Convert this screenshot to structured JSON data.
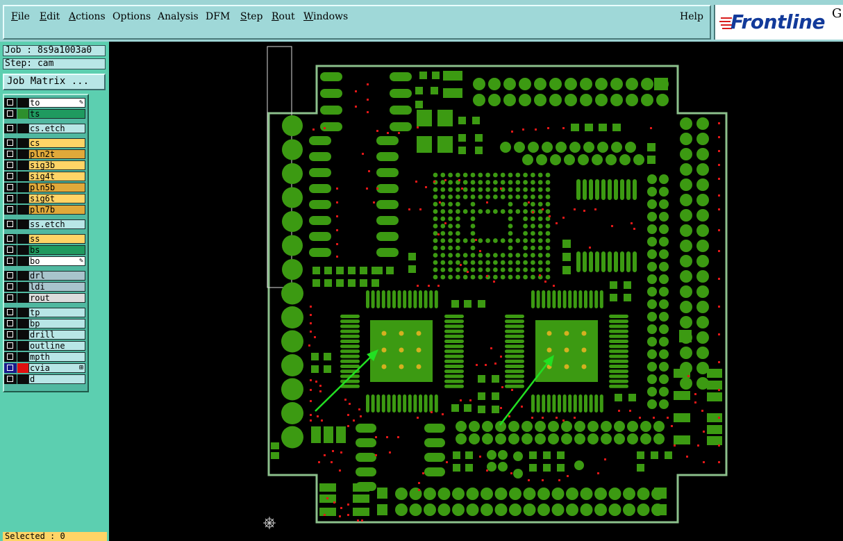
{
  "menu": {
    "items": [
      {
        "label": "File",
        "accel": 0
      },
      {
        "label": "Edit",
        "accel": 0
      },
      {
        "label": "Actions",
        "accel": 0
      },
      {
        "label": "Options",
        "accel": -1
      },
      {
        "label": "Analysis",
        "accel": -1
      },
      {
        "label": "DFM",
        "accel": -1
      },
      {
        "label": "Step",
        "accel": 0
      },
      {
        "label": "Rout",
        "accel": 0
      },
      {
        "label": "Windows",
        "accel": 0
      }
    ],
    "help_label": "Help"
  },
  "logo": {
    "text": "Frontline",
    "suffix": "G"
  },
  "job": {
    "label": "Job : 8s9a1003a0"
  },
  "step": {
    "label": "Step: cam"
  },
  "job_matrix_label": "Job Matrix ...",
  "layers": [
    {
      "name": "to",
      "color": "#ffffff",
      "swatch": "#0b0b0b",
      "mark": "✎",
      "gap": 0
    },
    {
      "name": "ts",
      "color": "#1f9a5f",
      "swatch": "#2d8f2d",
      "mark": "",
      "gap": 0
    },
    {
      "name": "cs.etch",
      "color": "#b8e6e6",
      "swatch": "#0b0b0b",
      "mark": "",
      "gap": 1
    },
    {
      "name": "cs",
      "color": "#ffd466",
      "swatch": "#0b0b0b",
      "mark": "",
      "gap": 1
    },
    {
      "name": "pln2t",
      "color": "#e0a93a",
      "swatch": "#0b0b0b",
      "mark": "",
      "gap": 0
    },
    {
      "name": "sig3b",
      "color": "#ffd466",
      "swatch": "#0b0b0b",
      "mark": "",
      "gap": 0
    },
    {
      "name": "sig4t",
      "color": "#ffd466",
      "swatch": "#0b0b0b",
      "mark": "",
      "gap": 0
    },
    {
      "name": "pln5b",
      "color": "#e0a93a",
      "swatch": "#0b0b0b",
      "mark": "",
      "gap": 0
    },
    {
      "name": "sig6t",
      "color": "#ffd466",
      "swatch": "#0b0b0b",
      "mark": "",
      "gap": 0
    },
    {
      "name": "pln7b",
      "color": "#e0a93a",
      "swatch": "#0b0b0b",
      "mark": "",
      "gap": 0
    },
    {
      "name": "ss.etch",
      "color": "#b8e6e6",
      "swatch": "#0b0b0b",
      "mark": "",
      "gap": 1
    },
    {
      "name": "ss",
      "color": "#ffd466",
      "swatch": "#0b0b0b",
      "mark": "",
      "gap": 1
    },
    {
      "name": "bs",
      "color": "#1f9a5f",
      "swatch": "#0b0b0b",
      "mark": "",
      "gap": 0
    },
    {
      "name": "bo",
      "color": "#ffffff",
      "swatch": "#0b0b0b",
      "mark": "✎",
      "gap": 0
    },
    {
      "name": "drl",
      "color": "#a8c4cc",
      "swatch": "#0b0b0b",
      "mark": "",
      "gap": 1
    },
    {
      "name": "ldi",
      "color": "#a8c4cc",
      "swatch": "#0b0b0b",
      "mark": "",
      "gap": 0
    },
    {
      "name": "rout",
      "color": "#dcdcdc",
      "swatch": "#0b0b0b",
      "mark": "",
      "gap": 0
    },
    {
      "name": "tp",
      "color": "#b8e6e6",
      "swatch": "#0b0b0b",
      "mark": "",
      "gap": 1
    },
    {
      "name": "bp",
      "color": "#b8e6e6",
      "swatch": "#0b0b0b",
      "mark": "",
      "gap": 0
    },
    {
      "name": "drill",
      "color": "#b8e6e6",
      "swatch": "#0b0b0b",
      "mark": "",
      "gap": 0
    },
    {
      "name": "outline",
      "color": "#b8e6e6",
      "swatch": "#0b0b0b",
      "mark": "",
      "gap": 0
    },
    {
      "name": "mpth",
      "color": "#b8e6e6",
      "swatch": "#0b0b0b",
      "mark": "",
      "gap": 0
    },
    {
      "name": "cvia",
      "color": "#b8e6e6",
      "swatch": "#e01010",
      "mark": "⊞",
      "gap": 0,
      "active": true
    },
    {
      "name": "d",
      "color": "#b8e6e6",
      "swatch": "#0b0b0b",
      "mark": "",
      "gap": 0
    }
  ],
  "status": {
    "selected": "Selected : 0"
  },
  "colors": {
    "pad": "#3c9a12",
    "via": "#e01818",
    "board_outline": "#8cc08c",
    "arrow": "#22e022",
    "bga_ball": "#d4b020"
  }
}
